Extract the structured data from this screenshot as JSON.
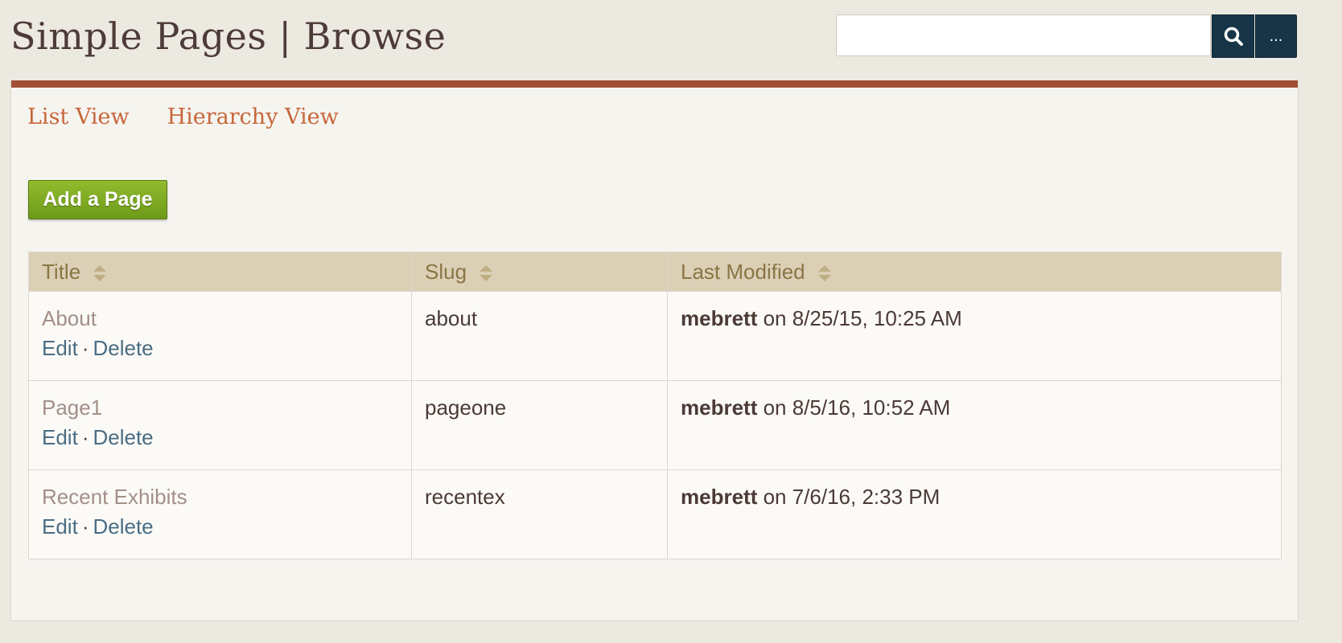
{
  "header": {
    "title": "Simple Pages | Browse",
    "search_placeholder": "",
    "search_icon": "search-icon",
    "more_label": "..."
  },
  "colors": {
    "accent_bar": "#a14f35",
    "link": "#c6663a",
    "button_green": "#7fa924",
    "search_button": "#173546",
    "table_header": "#dbd0b6"
  },
  "view_links": [
    {
      "label": "List View"
    },
    {
      "label": "Hierarchy View"
    }
  ],
  "add_button": {
    "label": "Add a Page"
  },
  "table": {
    "columns": [
      {
        "label": "Title"
      },
      {
        "label": "Slug"
      },
      {
        "label": "Last Modified"
      }
    ],
    "rows": [
      {
        "title": "About",
        "edit": "Edit",
        "sep": "·",
        "delete": "Delete",
        "slug": "about",
        "user": "mebrett",
        "on": " on 8/25/15, 10:25 AM"
      },
      {
        "title": "Page1",
        "edit": "Edit",
        "sep": "·",
        "delete": "Delete",
        "slug": "pageone",
        "user": "mebrett",
        "on": " on 8/5/16, 10:52 AM"
      },
      {
        "title": "Recent Exhibits",
        "edit": "Edit",
        "sep": "·",
        "delete": "Delete",
        "slug": "recentex",
        "user": "mebrett",
        "on": " on 7/6/16, 2:33 PM"
      }
    ]
  }
}
